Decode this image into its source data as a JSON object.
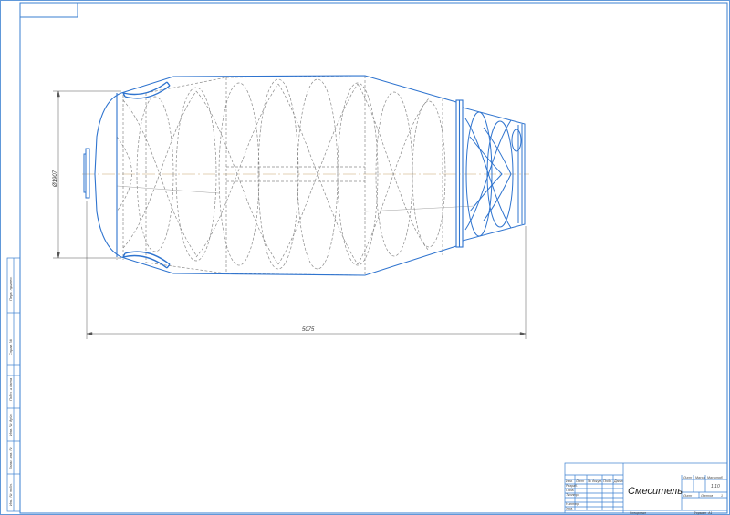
{
  "drawing": {
    "title": "Смеситель",
    "dimensions": {
      "overall_length": "5075",
      "diameter": "Ø1907"
    }
  },
  "title_block": {
    "scale": "1:10",
    "sheet_label": "Лист",
    "mass_label": "Масса",
    "scale_label": "Масштаб",
    "sheets_label": "Листов",
    "row_labels": [
      "Изм.",
      "Лист",
      "№ докум.",
      "Подп.",
      "Дата"
    ],
    "role_labels": [
      "Разраб.",
      "Пров.",
      "Т.контр.",
      "Н.контр.",
      "Утв."
    ],
    "copied_label": "Копировал",
    "format_label": "Формат",
    "format_value": "A1",
    "sheets_value": "1"
  },
  "left_strip": {
    "labels": [
      "Перв. примен.",
      "Справ. №",
      "Подп. и дата",
      "Инв. № дубл.",
      "Взам. инв. №",
      "Подп. и дата",
      "Инв. № подл."
    ]
  },
  "colors": {
    "frame": "#3a7fd0",
    "outline": "#2f74cf",
    "hidden": "#8a8a8a",
    "axis": "#c8a46a"
  }
}
